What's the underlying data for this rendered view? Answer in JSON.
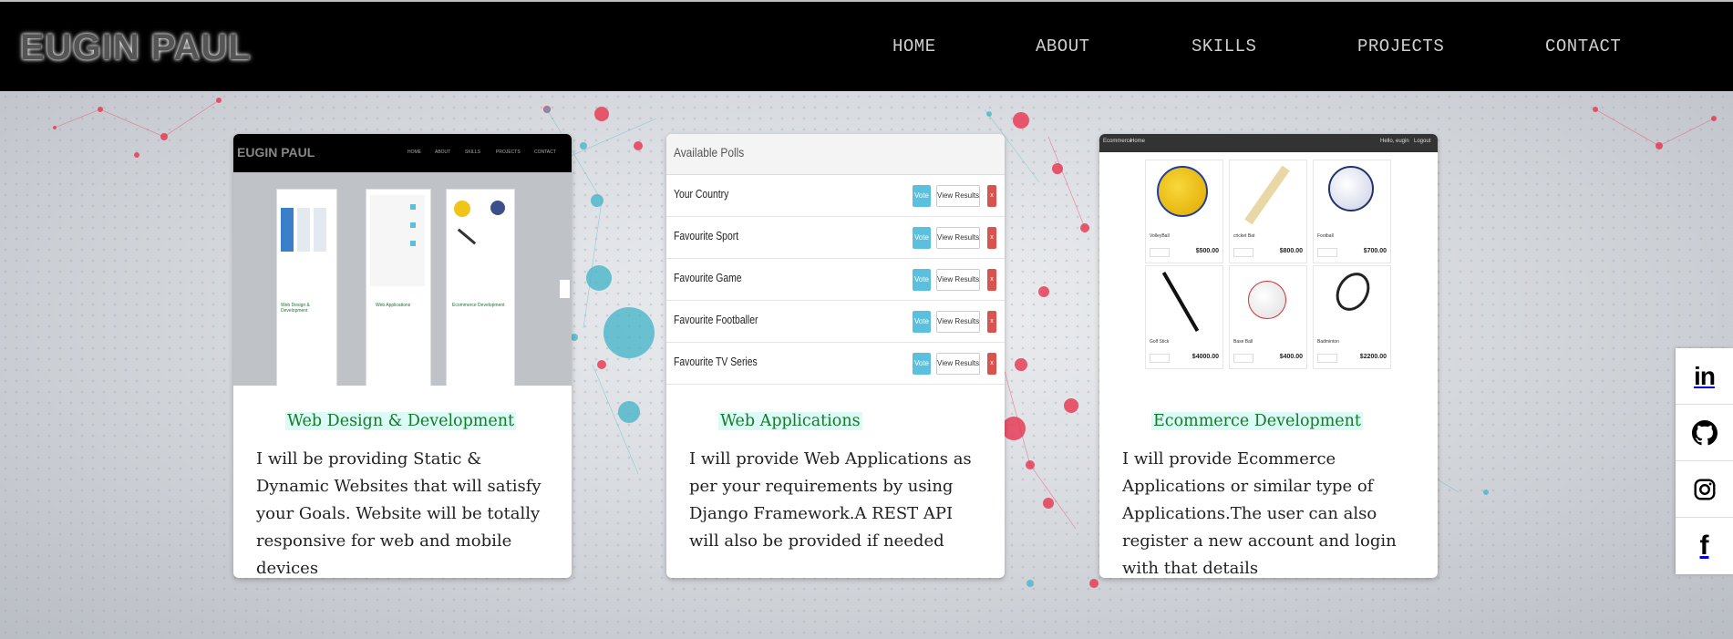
{
  "header": {
    "logo": "EUGIN PAUL",
    "nav": [
      "HOME",
      "ABOUT",
      "SKILLS",
      "PROJECTS",
      "CONTACT"
    ]
  },
  "cards": [
    {
      "title": "Web Design & Development",
      "description": "I will be providing Static & Dynamic Websites that will satisfy your Goals. Website will be totally responsive for web and mobile devices",
      "screenshot": {
        "logo": "EUGIN PAUL",
        "nav": [
          "HOME",
          "ABOUT",
          "SKILLS",
          "PROJECTS",
          "CONTACT"
        ],
        "cards": [
          "Web Design & Development",
          "Web Applications",
          "Ecommerce Development"
        ]
      }
    },
    {
      "title": "Web Applications",
      "description": "I will provide Web Applications as per your requirements by using Django Framework.A REST API will also be provided if needed",
      "screenshot": {
        "header": "Available Polls",
        "vote_label": "Vote",
        "results_label": "View Results",
        "delete_label": "x",
        "polls": [
          "Your Country",
          "Favourite Sport",
          "Favourite Game",
          "Favourite Footballer",
          "Favourite TV Series"
        ]
      }
    },
    {
      "title": "Ecommerce Development",
      "description": "I will provide Ecommerce Applications or similar type of Applications.The user can also register a new account and login with that details",
      "screenshot": {
        "brand": "Ecommerce",
        "home": "Home",
        "greeting": "Hello, eugin",
        "logout": "Logout",
        "products": [
          {
            "name": "VolleyBall",
            "price": "$500.00"
          },
          {
            "name": "cricket Bat",
            "price": "$800.00"
          },
          {
            "name": "Football",
            "price": "$700.00"
          },
          {
            "name": "Golf Stick",
            "price": "$4000.00"
          },
          {
            "name": "Base Ball",
            "price": "$400.00"
          },
          {
            "name": "Badminton",
            "price": "$2200.00"
          }
        ]
      }
    }
  ],
  "social": [
    "linkedin-icon",
    "github-icon",
    "instagram-icon",
    "facebook-icon"
  ],
  "colors": {
    "header_bg": "#000000",
    "nav_text": "#cfcfcf",
    "card_title": "#157a2a",
    "card_title_bg": "#dcfbf6",
    "accent_red": "#e8334f",
    "accent_teal": "#3fb3c8"
  }
}
